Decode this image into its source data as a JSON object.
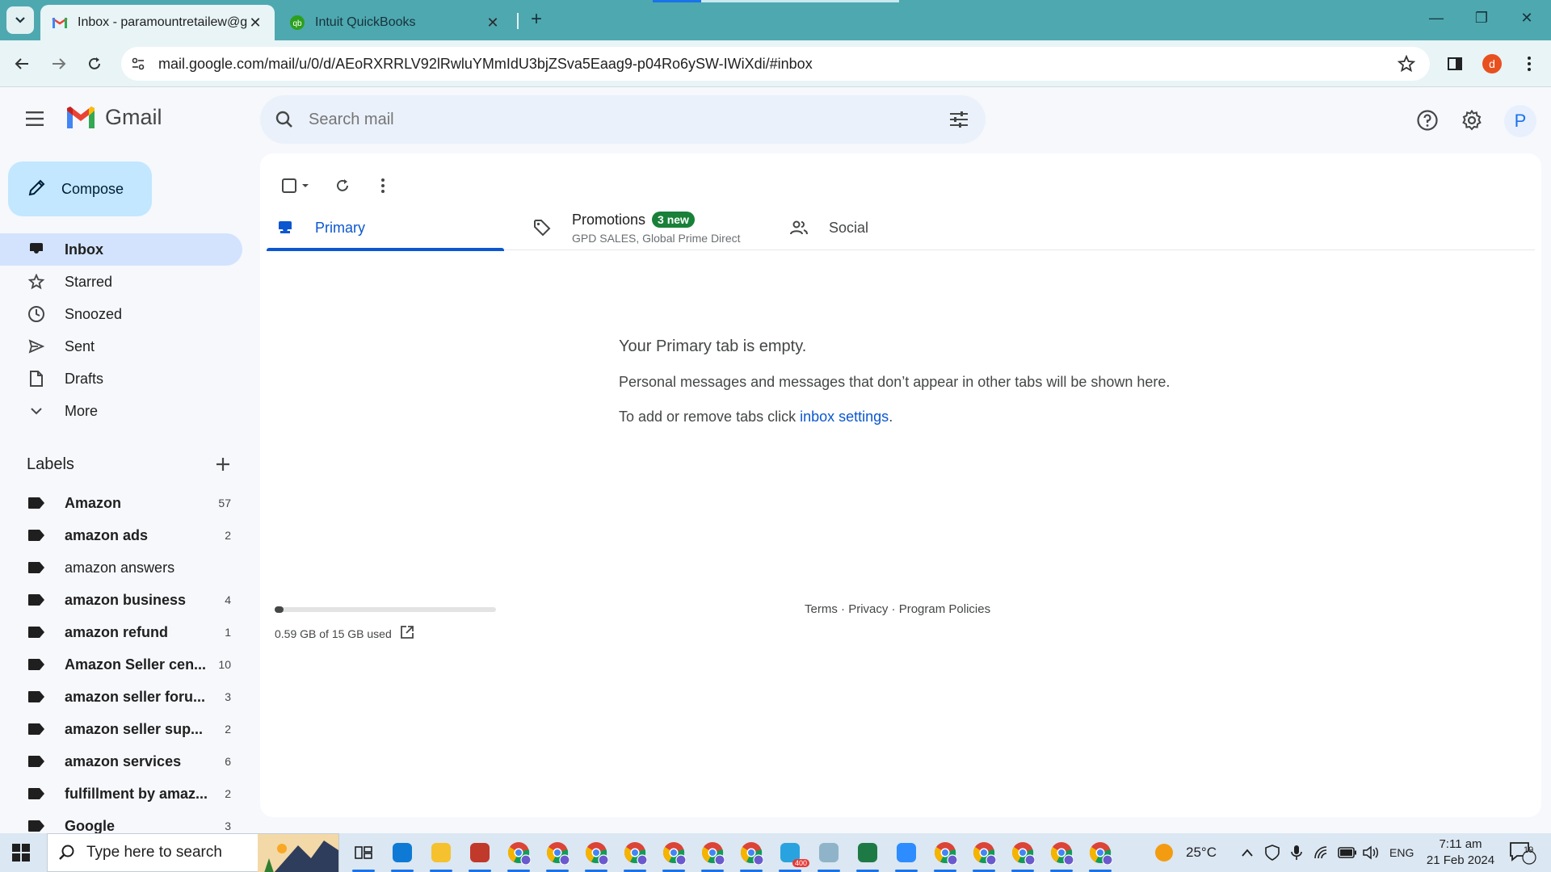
{
  "browser": {
    "tabs": [
      {
        "title": "Inbox - paramountretailew@gm",
        "active": true
      },
      {
        "title": "Intuit QuickBooks",
        "active": false
      }
    ],
    "url": "mail.google.com/mail/u/0/d/AEoRXRRLV92lRwluYMmIdU3bjZSva5Eaag9-p04Ro6ySW-IWiXdi/#inbox",
    "profile_initial": "d"
  },
  "gmail": {
    "brand": "Gmail",
    "search_placeholder": "Search mail",
    "avatar_initial": "P",
    "compose_label": "Compose",
    "nav": [
      {
        "label": "Inbox",
        "icon": "inbox-icon"
      },
      {
        "label": "Starred",
        "icon": "star-icon"
      },
      {
        "label": "Snoozed",
        "icon": "clock-icon"
      },
      {
        "label": "Sent",
        "icon": "send-icon"
      },
      {
        "label": "Drafts",
        "icon": "draft-icon"
      },
      {
        "label": "More",
        "icon": "chevron-down-icon"
      }
    ],
    "labels_title": "Labels",
    "labels": [
      {
        "name": "Amazon",
        "count": "57",
        "bold": true
      },
      {
        "name": "amazon ads",
        "count": "2",
        "bold": true
      },
      {
        "name": "amazon answers",
        "count": "",
        "bold": false
      },
      {
        "name": "amazon business",
        "count": "4",
        "bold": true
      },
      {
        "name": "amazon refund",
        "count": "1",
        "bold": true
      },
      {
        "name": "Amazon Seller cen...",
        "count": "10",
        "bold": true
      },
      {
        "name": "amazon seller foru...",
        "count": "3",
        "bold": true
      },
      {
        "name": "amazon seller sup...",
        "count": "2",
        "bold": true
      },
      {
        "name": "amazon services",
        "count": "6",
        "bold": true
      },
      {
        "name": "fulfillment by amaz...",
        "count": "2",
        "bold": true
      },
      {
        "name": "Google",
        "count": "3",
        "bold": true
      }
    ],
    "inbox_tabs": {
      "primary": "Primary",
      "promotions": "Promotions",
      "promotions_badge": "3 new",
      "promotions_senders": "GPD SALES, Global Prime Direct",
      "social": "Social"
    },
    "empty_state": {
      "heading": "Your Primary tab is empty.",
      "line1": "Personal messages and messages that don’t appear in other tabs will be shown here.",
      "line2_prefix": "To add or remove tabs click ",
      "line2_link": "inbox settings",
      "line2_suffix": "."
    },
    "storage": {
      "text": "0.59 GB of 15 GB used",
      "used_fraction": 0.039
    },
    "footer": {
      "terms": "Terms",
      "privacy": "Privacy",
      "policies": "Program Policies",
      "sep": " · "
    }
  },
  "taskbar": {
    "search_placeholder": "Type here to search",
    "weather": "25°C",
    "language": "ENG",
    "time": "7:11 am",
    "date": "21 Feb 2024",
    "notifications": "19",
    "telegram_badge": "400",
    "apps": [
      "task-view-icon",
      "edge-icon",
      "file-explorer-icon",
      "snipping-tool-icon",
      "chrome-profile-d-icon",
      "chrome-profile-b-icon",
      "chrome-profile-d2-icon",
      "chrome-profile-d3-icon",
      "chrome-profile-rc-icon",
      "chrome-profile-D-icon",
      "chrome-profile-a-icon",
      "telegram-icon",
      "notepad-icon",
      "excel-icon",
      "zoom-icon",
      "chrome-icon",
      "chrome-profile-user1-icon",
      "chrome-profile-user2-icon",
      "chrome-profile-user3-icon",
      "chrome-profile-user4-icon"
    ]
  }
}
